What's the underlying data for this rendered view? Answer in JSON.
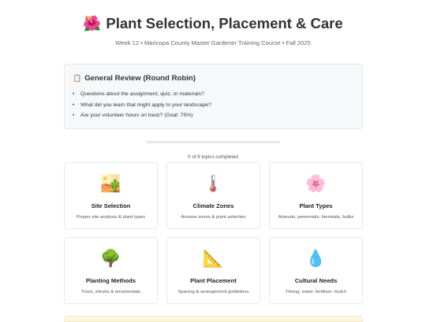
{
  "header": {
    "title_emoji": "🌺",
    "title": "Plant Selection, Placement & Care",
    "subtitle": "Week 12 • Maricopa County Master Gardener Training Course • Fall 2025"
  },
  "review": {
    "emoji": "📋",
    "title": "General Review (Round Robin)",
    "items": [
      "Questions about the assignment, quiz, or materials?",
      "What did you learn that might apply to your landscape?",
      "Are your volunteer hours on track? (Goal: 75%)"
    ]
  },
  "progress": {
    "completed": 0,
    "total": 6,
    "label": "0 of 6 topics completed",
    "colors": {
      "track": "#e6e8ec",
      "fill": "#7aa874"
    }
  },
  "topics": [
    {
      "icon": "🏜️",
      "icon_name": "desert-icon",
      "name": "Site Selection",
      "desc": "Proper site analysis & plant types"
    },
    {
      "icon": "🌡️",
      "icon_name": "thermometer-icon",
      "name": "Climate Zones",
      "desc": "Arizona zones & plant selection"
    },
    {
      "icon": "🌸",
      "icon_name": "blossom-icon",
      "name": "Plant Types",
      "desc": "Annuals, perennials, biennials, bulbs"
    },
    {
      "icon": "🌳",
      "icon_name": "tree-icon",
      "name": "Planting Methods",
      "desc": "Trees, shrubs & ornamentals"
    },
    {
      "icon": "📐",
      "icon_name": "triangle-ruler-icon",
      "name": "Plant Placement",
      "desc": "Spacing & arrangement guidelines"
    },
    {
      "icon": "💧",
      "icon_name": "water-drop-icon",
      "name": "Cultural Needs",
      "desc": "Timing, water, fertilizer, mulch"
    }
  ]
}
